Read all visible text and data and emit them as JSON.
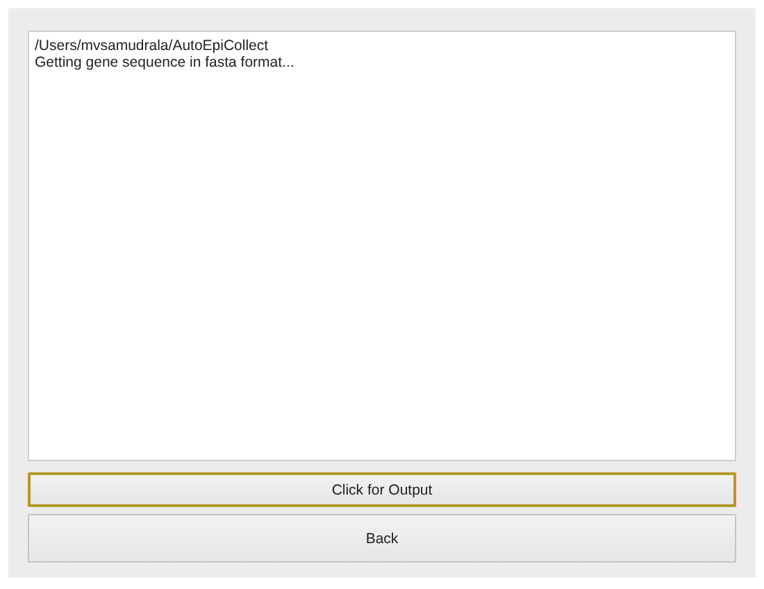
{
  "output_log": {
    "lines": [
      "/Users/mvsamudrala/AutoEpiCollect",
      "Getting gene sequence in fasta format..."
    ]
  },
  "buttons": [
    {
      "label": "Click for Output",
      "focused": true
    },
    {
      "label": "Back",
      "focused": false
    }
  ]
}
